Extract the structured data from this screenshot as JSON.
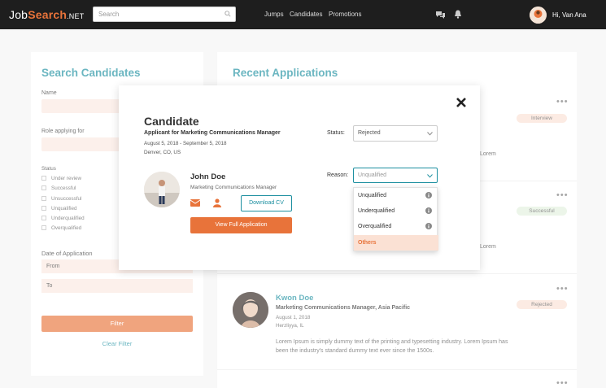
{
  "nav": {
    "logo_prefix": "Job",
    "logo_accent": "Search",
    "logo_tld": ".NET",
    "search_placeholder": "Search",
    "links": [
      "Jumps",
      "Candidates",
      "Promotions"
    ],
    "user": "Hi, Van Ana"
  },
  "search_panel": {
    "title": "Search Candidates",
    "name_label": "Name",
    "role_label": "Role applying for",
    "status_label": "Status",
    "statuses": [
      "Under review",
      "Successful",
      "Unsuccessful",
      "Unqualified",
      "Underqualified",
      "Overqualified"
    ],
    "date_label": "Date of Application",
    "from_label": "From",
    "to_label": "To",
    "filter_label": "Filter",
    "clear_label": "Clear Filter"
  },
  "recent": {
    "title": "Recent Applications",
    "badges": [
      "Interview",
      "Successful",
      "Rejected"
    ],
    "badge_colors": [
      "#fbe1d4",
      "#e2f0de",
      "#fbe1d4"
    ],
    "peek_texts": [
      "Lorem",
      "Lorem"
    ],
    "card": {
      "name": "Kwon Doe",
      "role": "Marketing Communications Manager, Asia Pacific",
      "date": "August 1, 2018",
      "location": "Herzliyya, IL",
      "description": "Lorem Ipsum is simply dummy text of the printing and typesetting industry. Lorem Ipsum has been the industry's standard dummy text ever since the 1500s."
    }
  },
  "modal": {
    "title": "Candidate",
    "subtitle": "Applicant for Marketing Communications Manager",
    "dates": "August 5, 2018 - September 5, 2018",
    "location": "Denver, CO, US",
    "candidate_name": "John Doe",
    "candidate_role": "Marketing Communications Manager",
    "download_cv": "Download CV",
    "view_full": "View Full Application",
    "status_label": "Status:",
    "status_value": "Rejected",
    "reason_label": "Reason:",
    "reason_value": "Unqualified",
    "reason_options": [
      "Unqualified",
      "Underqualified",
      "Overqualified",
      "Others"
    ]
  },
  "colors": {
    "accent": "#e8733a",
    "teal": "#1c8fa0",
    "topbar": "#1e1e1e"
  }
}
